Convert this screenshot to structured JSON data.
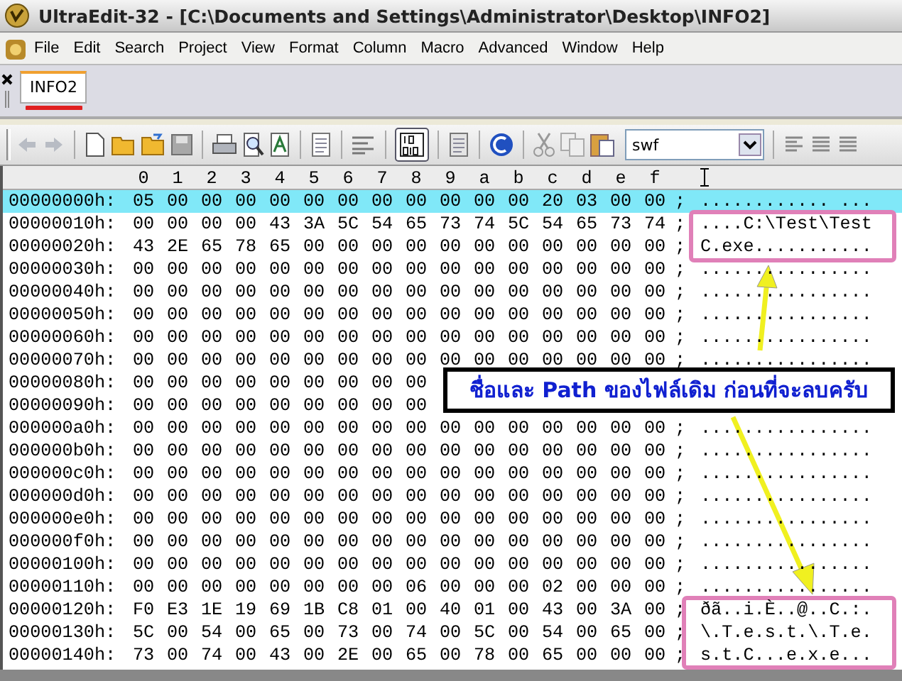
{
  "window": {
    "title": "UltraEdit-32 - [C:\\Documents and Settings\\Administrator\\Desktop\\INFO2]"
  },
  "menu": [
    "File",
    "Edit",
    "Search",
    "Project",
    "View",
    "Format",
    "Column",
    "Macro",
    "Advanced",
    "Window",
    "Help"
  ],
  "tabs": [
    {
      "label": "INFO2",
      "selected": true,
      "underlined": true
    }
  ],
  "toolbar": {
    "combo_value": "swf"
  },
  "hex": {
    "columns": [
      "0",
      "1",
      "2",
      "3",
      "4",
      "5",
      "6",
      "7",
      "8",
      "9",
      "a",
      "b",
      "c",
      "d",
      "e",
      "f"
    ],
    "rows": [
      {
        "address": "00000000h:",
        "bytes": [
          "05",
          "00",
          "00",
          "00",
          "00",
          "00",
          "00",
          "00",
          "00",
          "00",
          "00",
          "00",
          "20",
          "03",
          "00",
          "00"
        ],
        "separator": ";",
        "ascii": "............ ...",
        "selected": true
      },
      {
        "address": "00000010h:",
        "bytes": [
          "00",
          "00",
          "00",
          "00",
          "43",
          "3A",
          "5C",
          "54",
          "65",
          "73",
          "74",
          "5C",
          "54",
          "65",
          "73",
          "74"
        ],
        "separator": ";",
        "ascii": "....C:\\Test\\Test",
        "selected": false
      },
      {
        "address": "00000020h:",
        "bytes": [
          "43",
          "2E",
          "65",
          "78",
          "65",
          "00",
          "00",
          "00",
          "00",
          "00",
          "00",
          "00",
          "00",
          "00",
          "00",
          "00"
        ],
        "separator": ";",
        "ascii": "C.exe...........",
        "selected": false
      },
      {
        "address": "00000030h:",
        "bytes": [
          "00",
          "00",
          "00",
          "00",
          "00",
          "00",
          "00",
          "00",
          "00",
          "00",
          "00",
          "00",
          "00",
          "00",
          "00",
          "00"
        ],
        "separator": ";",
        "ascii": "................",
        "selected": false
      },
      {
        "address": "00000040h:",
        "bytes": [
          "00",
          "00",
          "00",
          "00",
          "00",
          "00",
          "00",
          "00",
          "00",
          "00",
          "00",
          "00",
          "00",
          "00",
          "00",
          "00"
        ],
        "separator": ";",
        "ascii": "................",
        "selected": false
      },
      {
        "address": "00000050h:",
        "bytes": [
          "00",
          "00",
          "00",
          "00",
          "00",
          "00",
          "00",
          "00",
          "00",
          "00",
          "00",
          "00",
          "00",
          "00",
          "00",
          "00"
        ],
        "separator": ";",
        "ascii": "................",
        "selected": false
      },
      {
        "address": "00000060h:",
        "bytes": [
          "00",
          "00",
          "00",
          "00",
          "00",
          "00",
          "00",
          "00",
          "00",
          "00",
          "00",
          "00",
          "00",
          "00",
          "00",
          "00"
        ],
        "separator": ";",
        "ascii": "................",
        "selected": false
      },
      {
        "address": "00000070h:",
        "bytes": [
          "00",
          "00",
          "00",
          "00",
          "00",
          "00",
          "00",
          "00",
          "00",
          "00",
          "00",
          "00",
          "00",
          "00",
          "00",
          "00"
        ],
        "separator": ";",
        "ascii": "................",
        "selected": false
      },
      {
        "address": "00000080h:",
        "bytes": [
          "00",
          "00",
          "00",
          "00",
          "00",
          "00",
          "00",
          "00",
          "00"
        ],
        "selected": false
      },
      {
        "address": "00000090h:",
        "bytes": [
          "00",
          "00",
          "00",
          "00",
          "00",
          "00",
          "00",
          "00",
          "00"
        ],
        "selected": false
      },
      {
        "address": "000000a0h:",
        "bytes": [
          "00",
          "00",
          "00",
          "00",
          "00",
          "00",
          "00",
          "00",
          "00",
          "00",
          "00",
          "00",
          "00",
          "00",
          "00",
          "00"
        ],
        "separator": ";",
        "ascii": "................",
        "selected": false
      },
      {
        "address": "000000b0h:",
        "bytes": [
          "00",
          "00",
          "00",
          "00",
          "00",
          "00",
          "00",
          "00",
          "00",
          "00",
          "00",
          "00",
          "00",
          "00",
          "00",
          "00"
        ],
        "separator": ";",
        "ascii": "................",
        "selected": false
      },
      {
        "address": "000000c0h:",
        "bytes": [
          "00",
          "00",
          "00",
          "00",
          "00",
          "00",
          "00",
          "00",
          "00",
          "00",
          "00",
          "00",
          "00",
          "00",
          "00",
          "00"
        ],
        "separator": ";",
        "ascii": "................",
        "selected": false
      },
      {
        "address": "000000d0h:",
        "bytes": [
          "00",
          "00",
          "00",
          "00",
          "00",
          "00",
          "00",
          "00",
          "00",
          "00",
          "00",
          "00",
          "00",
          "00",
          "00",
          "00"
        ],
        "separator": ";",
        "ascii": "................",
        "selected": false
      },
      {
        "address": "000000e0h:",
        "bytes": [
          "00",
          "00",
          "00",
          "00",
          "00",
          "00",
          "00",
          "00",
          "00",
          "00",
          "00",
          "00",
          "00",
          "00",
          "00",
          "00"
        ],
        "separator": ";",
        "ascii": "................",
        "selected": false
      },
      {
        "address": "000000f0h:",
        "bytes": [
          "00",
          "00",
          "00",
          "00",
          "00",
          "00",
          "00",
          "00",
          "00",
          "00",
          "00",
          "00",
          "00",
          "00",
          "00",
          "00"
        ],
        "separator": ";",
        "ascii": "................",
        "selected": false
      },
      {
        "address": "00000100h:",
        "bytes": [
          "00",
          "00",
          "00",
          "00",
          "00",
          "00",
          "00",
          "00",
          "00",
          "00",
          "00",
          "00",
          "00",
          "00",
          "00",
          "00"
        ],
        "separator": ";",
        "ascii": "................",
        "selected": false
      },
      {
        "address": "00000110h:",
        "bytes": [
          "00",
          "00",
          "00",
          "00",
          "00",
          "00",
          "00",
          "00",
          "06",
          "00",
          "00",
          "00",
          "02",
          "00",
          "00",
          "00"
        ],
        "separator": ";",
        "ascii": "................",
        "selected": false
      },
      {
        "address": "00000120h:",
        "bytes": [
          "F0",
          "E3",
          "1E",
          "19",
          "69",
          "1B",
          "C8",
          "01",
          "00",
          "40",
          "01",
          "00",
          "43",
          "00",
          "3A",
          "00"
        ],
        "separator": ";",
        "ascii": "ðã..i.È..@..C.:.",
        "selected": false
      },
      {
        "address": "00000130h:",
        "bytes": [
          "5C",
          "00",
          "54",
          "00",
          "65",
          "00",
          "73",
          "00",
          "74",
          "00",
          "5C",
          "00",
          "54",
          "00",
          "65",
          "00"
        ],
        "separator": ";",
        "ascii": "\\.T.e.s.t.\\.T.e.",
        "selected": false
      },
      {
        "address": "00000140h:",
        "bytes": [
          "73",
          "00",
          "74",
          "00",
          "43",
          "00",
          "2E",
          "00",
          "65",
          "00",
          "78",
          "00",
          "65",
          "00",
          "00",
          "00"
        ],
        "separator": ";",
        "ascii": "s.t.C...e.x.e...",
        "selected": false
      }
    ]
  },
  "callout": {
    "text": "ชื่อและ Path ของไฟล์เดิม ก่อนที่จะลบครับ"
  }
}
